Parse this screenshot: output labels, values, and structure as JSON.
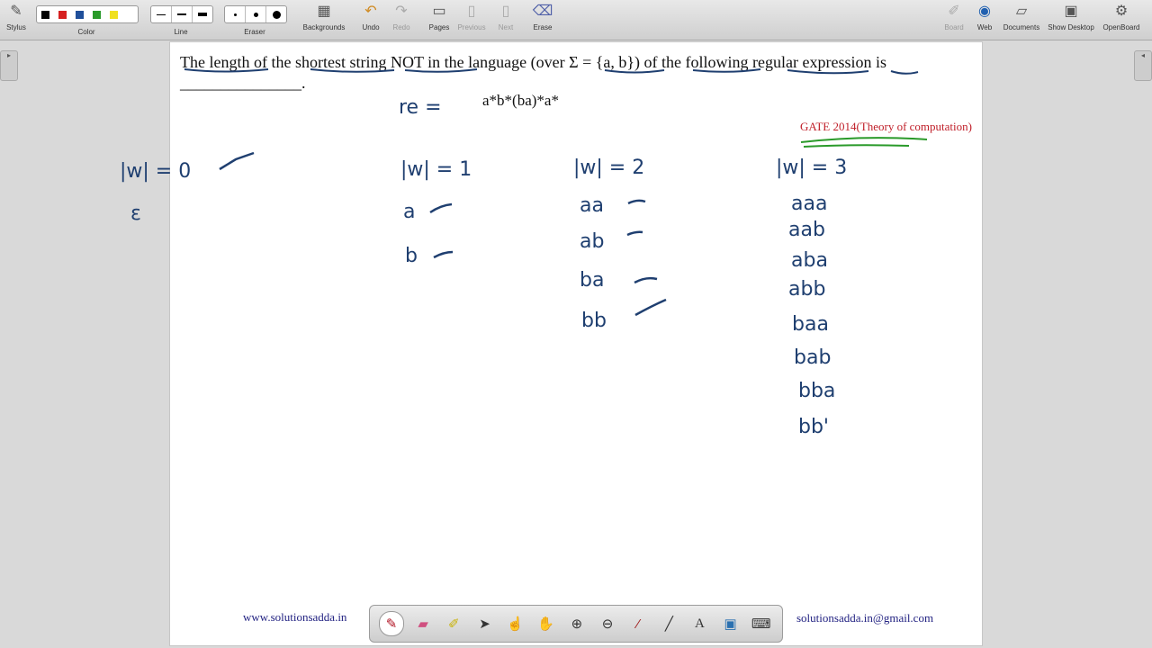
{
  "toolbar": {
    "stylus": "Stylus",
    "color": "Color",
    "line": "Line",
    "eraser": "Eraser",
    "backgrounds": "Backgrounds",
    "undo": "Undo",
    "redo": "Redo",
    "pages": "Pages",
    "previous": "Previous",
    "next": "Next",
    "erase": "Erase",
    "board": "Board",
    "web": "Web",
    "documents": "Documents",
    "show_desktop": "Show Desktop",
    "openboard": "OpenBoard",
    "colors": [
      "#000000",
      "#d62020",
      "#1f4f9a",
      "#2a9a2a",
      "#f0e020"
    ]
  },
  "question": {
    "p1": "The length of",
    "p2": " the ",
    "p3": "shortest string",
    "p4": " NOT in the",
    "p5": " language (over Σ = ",
    "p6": "{a, b}",
    "p7": ") of ",
    "p8": "the following",
    "p9": " regular expression is",
    "blank": "_______________."
  },
  "regex_label": "re =",
  "regex": "a*b*(ba)*a*",
  "gate_tag": "GATE 2014(Theory of computation)",
  "handwriting": {
    "col0_header": "|w| = 0",
    "col0_items": [
      "ε"
    ],
    "col1_header": "|w| = 1",
    "col1_items": [
      "a",
      "b"
    ],
    "col2_header": "|w| = 2",
    "col2_items": [
      "aa",
      "ab",
      "ba",
      "bb"
    ],
    "col3_header": "|w| = 3",
    "col3_items": [
      "aaa",
      "aab",
      "aba",
      "abb",
      "baa",
      "bab",
      "bba",
      "bb'"
    ]
  },
  "footer": {
    "website": "www.solutionsadda.in",
    "email": "solutionsadda.in@gmail.com"
  },
  "ink_color": "#1f3f70",
  "accent_red": "#c0202a",
  "green_mark": "#2a9a2a"
}
